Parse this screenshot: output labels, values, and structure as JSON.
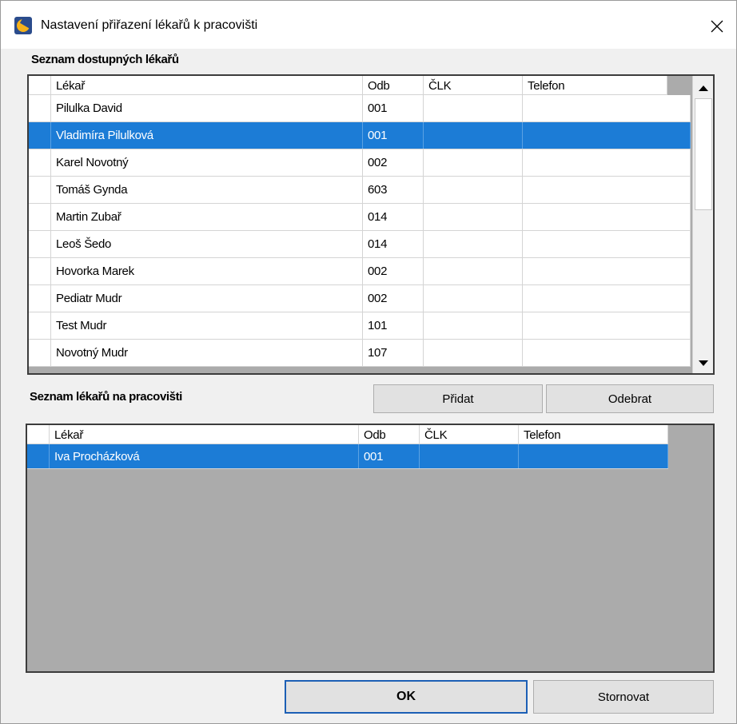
{
  "window": {
    "title": "Nastavení přiřazení lékařů k pracovišti"
  },
  "available": {
    "label": "Seznam dostupných lékařů",
    "columns": [
      "Lékař",
      "Odb",
      "ČLK",
      "Telefon"
    ],
    "rows": [
      {
        "name": "Pilulka David",
        "odb": "001",
        "clk": "",
        "telefon": "",
        "selected": false
      },
      {
        "name": "Vladimíra Pilulková",
        "odb": "001",
        "clk": "",
        "telefon": "",
        "selected": true
      },
      {
        "name": "Karel Novotný",
        "odb": "002",
        "clk": "",
        "telefon": "",
        "selected": false
      },
      {
        "name": "Tomáš Gynda",
        "odb": "603",
        "clk": "",
        "telefon": "",
        "selected": false
      },
      {
        "name": "Martin Zubař",
        "odb": "014",
        "clk": "",
        "telefon": "",
        "selected": false
      },
      {
        "name": "Leoš Šedo",
        "odb": "014",
        "clk": "",
        "telefon": "",
        "selected": false
      },
      {
        "name": "Hovorka Marek",
        "odb": "002",
        "clk": "",
        "telefon": "",
        "selected": false
      },
      {
        "name": "Pediatr Mudr",
        "odb": "002",
        "clk": "",
        "telefon": "",
        "selected": false
      },
      {
        "name": "Test Mudr",
        "odb": "101",
        "clk": "",
        "telefon": "",
        "selected": false
      },
      {
        "name": "Novotný Mudr",
        "odb": "107",
        "clk": "",
        "telefon": "",
        "selected": false
      }
    ]
  },
  "assigned": {
    "label": "Seznam lékařů na pracovišti",
    "columns": [
      "Lékař",
      "Odb",
      "ČLK",
      "Telefon"
    ],
    "rows": [
      {
        "name": "Iva Procházková",
        "odb": "001",
        "clk": "",
        "telefon": "",
        "selected": true
      }
    ]
  },
  "buttons": {
    "add": "Přidat",
    "remove": "Odebrat",
    "ok": "OK",
    "cancel": "Stornovat"
  },
  "icons": {
    "app": "app-logo-icon",
    "close": "close-icon",
    "scroll_up": "scroll-up-arrow-icon",
    "scroll_down": "scroll-down-arrow-icon"
  },
  "colors": {
    "selection": "#1c7cd6",
    "grid_background": "#ababab",
    "dialog_background": "#f0f0f0"
  }
}
